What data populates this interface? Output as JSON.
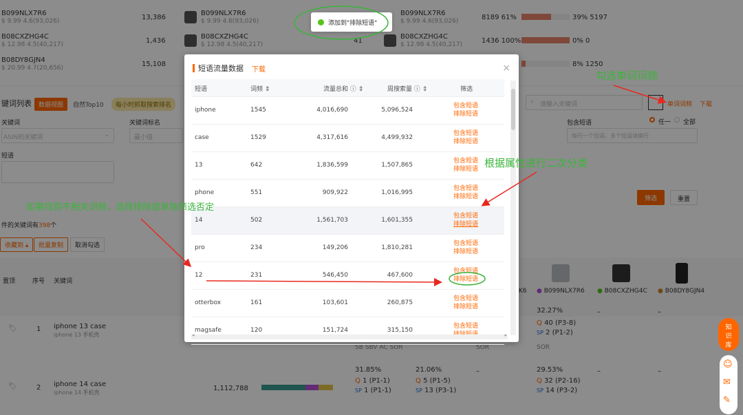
{
  "top_rows": [
    {
      "sku": "B099NLX7R6",
      "price": "$ 9.99  4.6(93,026)",
      "count": "13,386",
      "sku2": "B099NLX7R6",
      "price2": "$ 9.99  4.6(93,026)",
      "sku3": "B099NLX7R6",
      "price3": "$ 9.99  4.6(93,026)",
      "metric": "8189 61%",
      "metric2": "39% 5197"
    },
    {
      "sku": "B08CXZHG4C",
      "price": "$ 12.98  4.5(40,217)",
      "count": "1,436",
      "sku2": "B08CXZHG4C",
      "price2": "$ 12.98  4.5(40,217)",
      "mid": "41",
      "sku3": "B08CXZHG4C",
      "price3": "$ 12.98  4.5(40,217)",
      "metric": "1436 100%",
      "metric2": "0% 0"
    },
    {
      "sku": "B08DY8GJN4",
      "price": "$ 20.99  4.7(20,656)",
      "count": "15,108",
      "metric2": "8% 1250"
    }
  ],
  "keyword_list": {
    "title": "键词列表",
    "tab_data": "数据视图",
    "tab_natural": "自然Top10",
    "tab_hourly": "每小时抓取搜索排名",
    "search_placeholder": "请输入关键词",
    "word_freq": "单词词频",
    "download": "下载",
    "label_keyword": "关键词",
    "label_keyword_tag": "关键词标名",
    "asin_placeholder": "ASIN的关键词",
    "min_placeholder": "最小值",
    "label_phrase": "短语",
    "label_contains": "包含短语",
    "contains_placeholder": "每行一个短语，多个短语请换行",
    "opt_any": "任一",
    "opt_all": "全部",
    "filter": "筛选",
    "reset": "重置",
    "count_text_a": "件的关键词有",
    "count_value": "398",
    "count_text_b": "个",
    "btn_collect": "收藏到",
    "btn_batch_copy": "批量复制",
    "btn_cancel": "取消勾选",
    "col_pin": "置顶",
    "col_index": "序号",
    "col_keyword": "关键词",
    "rows": [
      {
        "index": "1",
        "keyword": "iphone 13 case",
        "cn": "iphone 13 手机壳"
      },
      {
        "index": "2",
        "keyword": "iphone 14 case",
        "cn": "iphone 14 手机壳",
        "volume": "1,112,788"
      }
    ],
    "col_k6": "K6",
    "asins": [
      {
        "name": "B099NLX7R6",
        "color": "#b44fd6"
      },
      {
        "name": "B08CXZHG4C",
        "color": "#52c41a"
      },
      {
        "name": "B08DY8GJN4",
        "color": "#c8842c"
      }
    ],
    "r1_pct": "32.27%",
    "r1_q": "40 (P3-8)",
    "r1_sp": "2 (P1-2)",
    "dash": "–",
    "sub_header": "SB SBV AC SOR",
    "sor1": "SOR",
    "sor2": "SOR",
    "r2_pct1": "31.85%",
    "r2_q1": "1 (P1-1)",
    "r2_sp1": "1 (P1-1)",
    "r2_pct2": "21.06%",
    "r2_q2": "5 (P1-5)",
    "r2_sp2": "13 (P3-1)",
    "r2_pct3": "29.53%",
    "r2_q3": "32 (P2-16)",
    "r2_sp3": "14 (P3-2)",
    "q_label": "Q",
    "sp_label": "SP"
  },
  "modal": {
    "title": "短语流量数据",
    "download": "下载",
    "close": "×",
    "headers": {
      "phrase": "短语",
      "freq": "词频",
      "traffic": "流量总和",
      "weekly": "周搜索量",
      "filter": "筛选"
    },
    "include": "包含短语",
    "exclude": "排除短语",
    "rows": [
      {
        "phrase": "iphone",
        "freq": "1545",
        "traffic": "4,016,690",
        "weekly": "5,096,524"
      },
      {
        "phrase": "case",
        "freq": "1529",
        "traffic": "4,317,616",
        "weekly": "4,499,932"
      },
      {
        "phrase": "13",
        "freq": "642",
        "traffic": "1,836,599",
        "weekly": "1,507,865"
      },
      {
        "phrase": "phone",
        "freq": "551",
        "traffic": "909,922",
        "weekly": "1,016,995"
      },
      {
        "phrase": "14",
        "freq": "502",
        "traffic": "1,561,703",
        "weekly": "1,601,355"
      },
      {
        "phrase": "pro",
        "freq": "234",
        "traffic": "149,206",
        "weekly": "1,810,281"
      },
      {
        "phrase": "12",
        "freq": "231",
        "traffic": "546,450",
        "weekly": "467,600"
      },
      {
        "phrase": "otterbox",
        "freq": "161",
        "traffic": "103,601",
        "weekly": "260,875"
      },
      {
        "phrase": "magsafe",
        "freq": "120",
        "traffic": "151,724",
        "weekly": "315,150"
      }
    ]
  },
  "toast": "添加到\"排除短语\"",
  "annotations": {
    "a1": "勾选单词词频",
    "a2": "根据属性进行二次分类",
    "a3": "如果找到不相关词频，选择排除或单独筛选否定"
  },
  "side": {
    "knowledge": "知识库"
  },
  "colors": {
    "accent": "#ff6600",
    "annotation": "#3ab53a",
    "arrow": "#e8281f"
  }
}
